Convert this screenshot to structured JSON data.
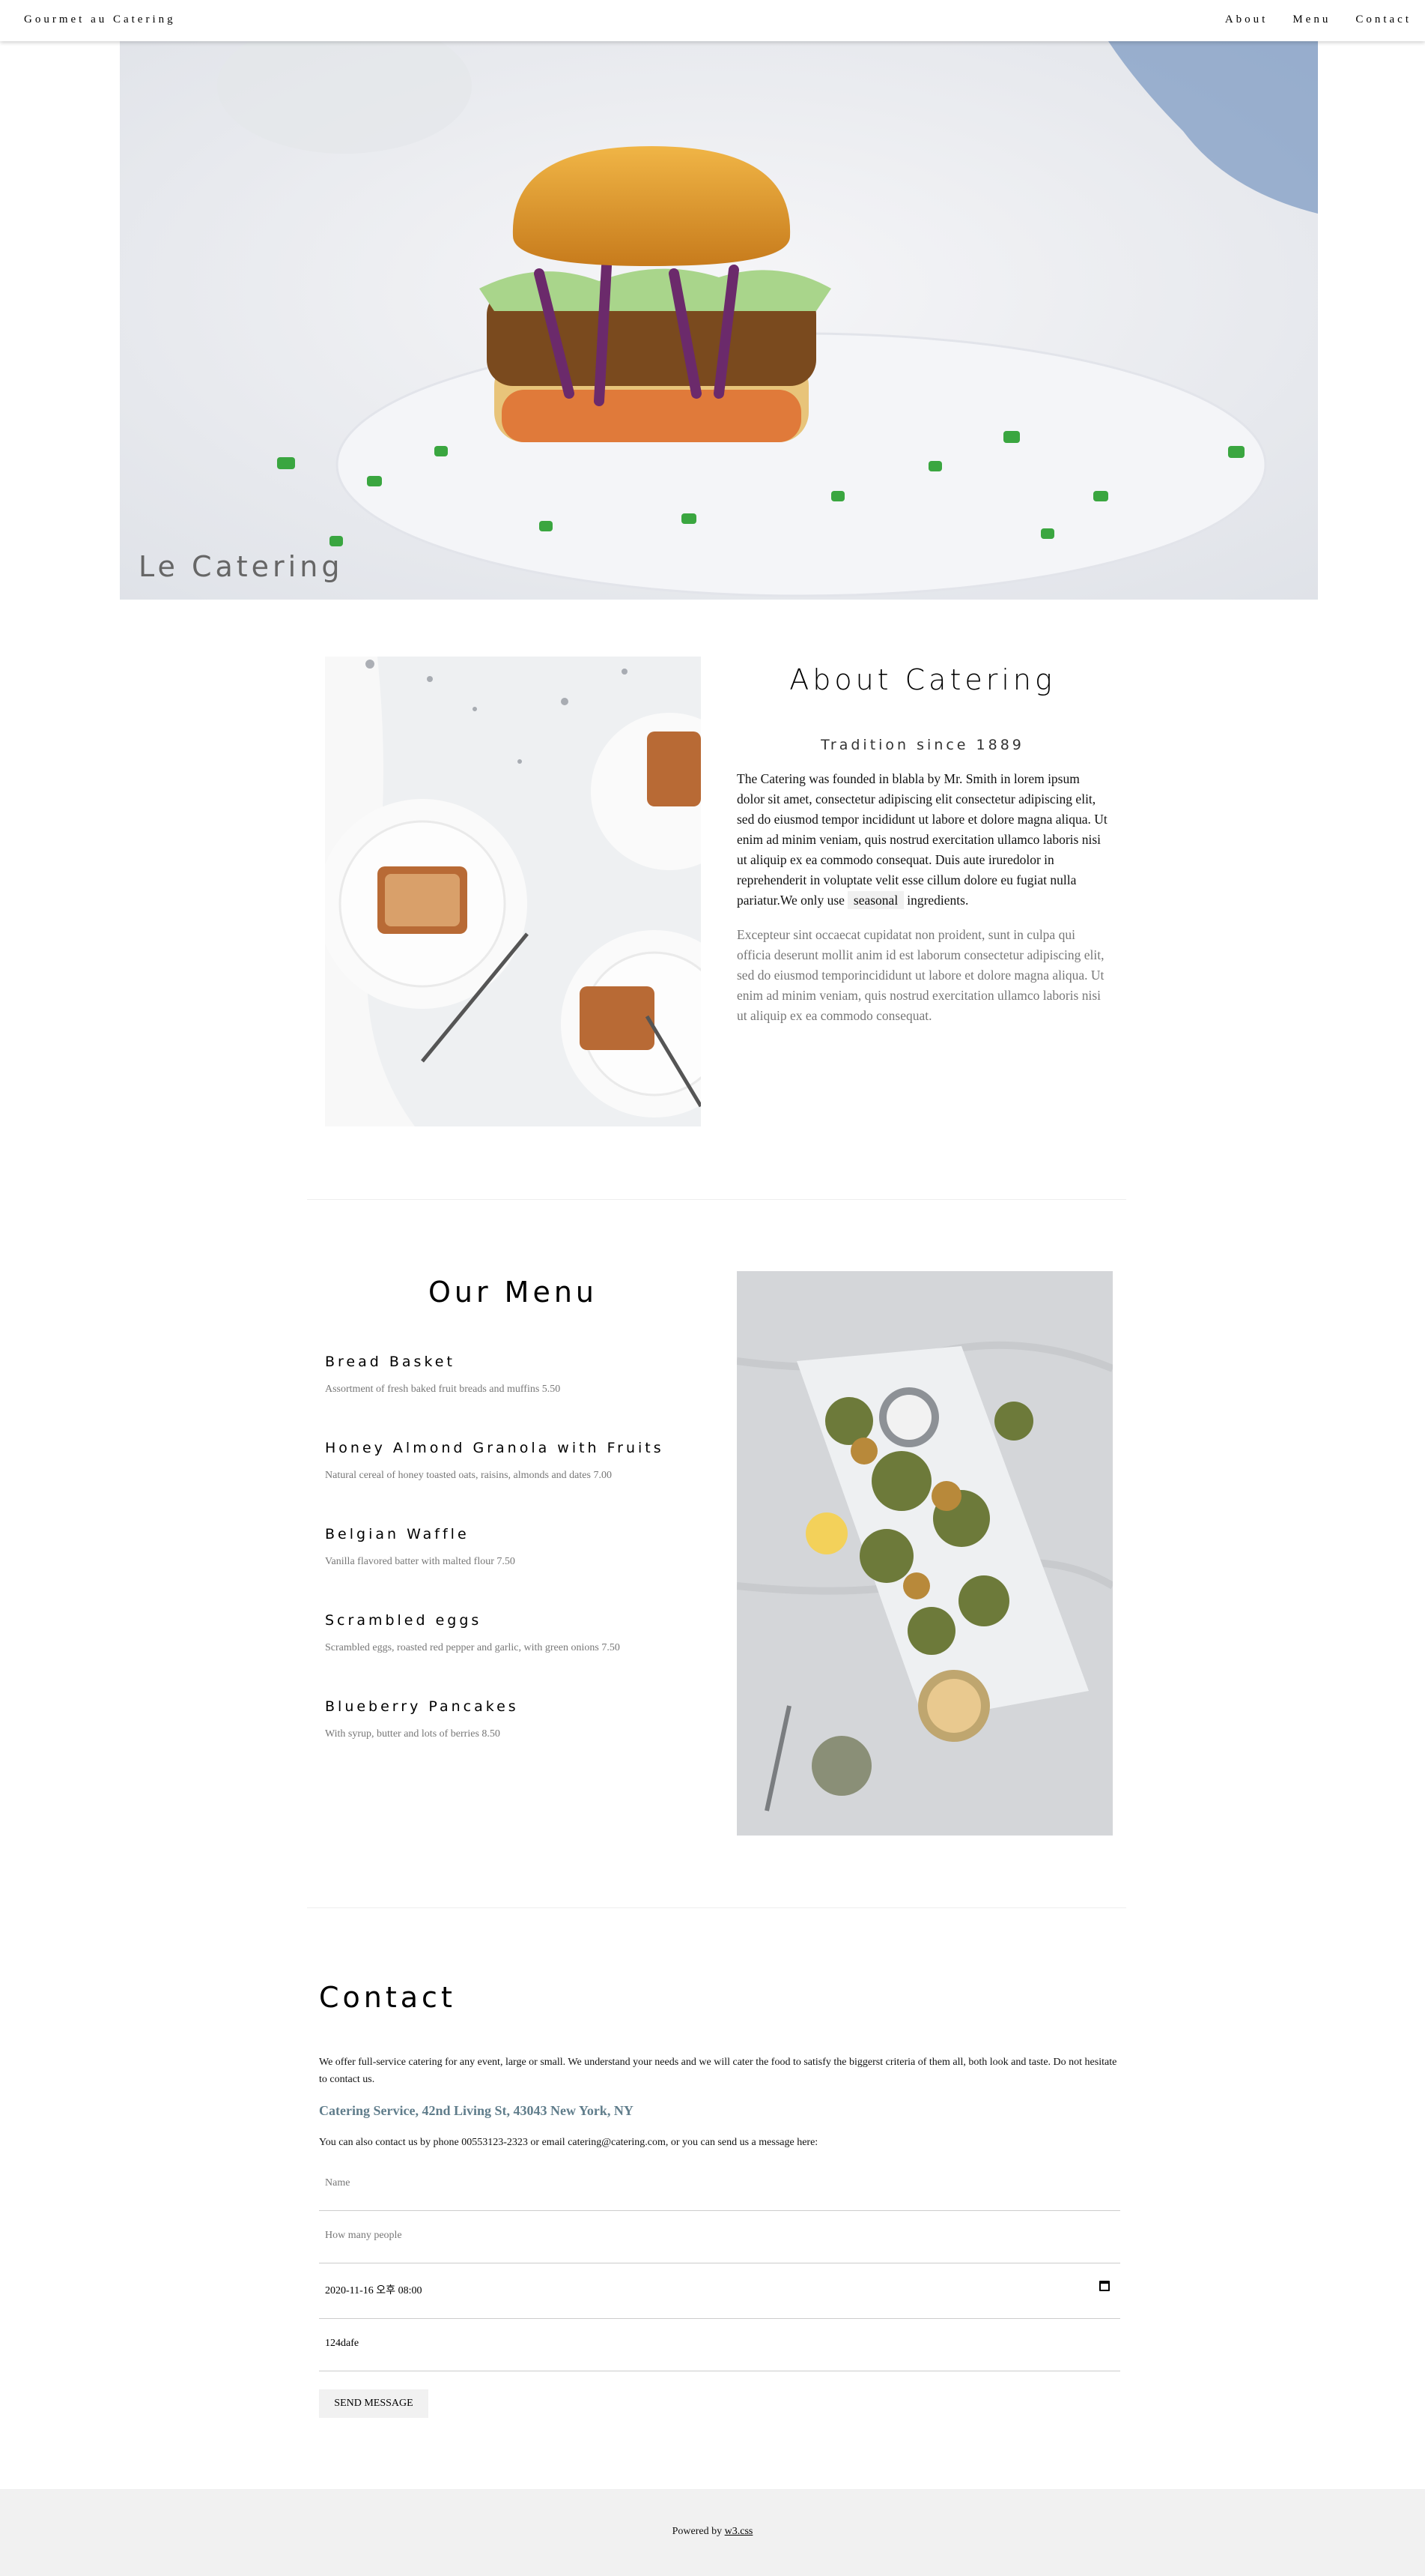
{
  "topbar": {
    "brand": "Gourmet au Catering",
    "nav": [
      "About",
      "Menu",
      "Contact"
    ]
  },
  "hero": {
    "caption": "Le Catering"
  },
  "about": {
    "title": "About Catering",
    "subtitle": "Tradition since 1889",
    "p1_before": "The Catering was founded in blabla by Mr. Smith in lorem ipsum dolor sit amet, consectetur adipiscing elit consectetur adipiscing elit, sed do eiusmod tempor incididunt ut labore et dolore magna aliqua. Ut enim ad minim veniam, quis nostrud exercitation ullamco laboris nisi ut aliquip ex ea commodo consequat. Duis aute iruredolor in reprehenderit in voluptate velit esse cillum dolore eu fugiat nulla pariatur.We only use",
    "p1_tag": "seasonal",
    "p1_after": "ingredients.",
    "p2": "Excepteur sint occaecat cupidatat non proident, sunt in culpa qui officia deserunt mollit anim id est laborum consectetur adipiscing elit, sed do eiusmod temporincididunt ut labore et dolore magna aliqua. Ut enim ad minim veniam, quis nostrud exercitation ullamco laboris nisi ut aliquip ex ea commodo consequat."
  },
  "menu": {
    "title": "Our Menu",
    "items": [
      {
        "name": "Bread Basket",
        "desc": "Assortment of fresh baked fruit breads and muffins 5.50"
      },
      {
        "name": "Honey Almond Granola with Fruits",
        "desc": "Natural cereal of honey toasted oats, raisins, almonds and dates 7.00"
      },
      {
        "name": "Belgian Waffle",
        "desc": "Vanilla flavored batter with malted flour 7.50"
      },
      {
        "name": "Scrambled eggs",
        "desc": "Scrambled eggs, roasted red pepper and garlic, with green onions 7.50"
      },
      {
        "name": "Blueberry Pancakes",
        "desc": "With syrup, butter and lots of berries 8.50"
      }
    ]
  },
  "contact": {
    "title": "Contact",
    "intro": "We offer full-service catering for any event, large or small. We understand your needs and we will cater the food to satisfy the biggerst criteria of them all, both look and taste. Do not hesitate to contact us.",
    "address": "Catering Service, 42nd Living St, 43043 New York, NY",
    "phone_line": "You can also contact us by phone 00553123-2323 or email catering@catering.com, or you can send us a message here:",
    "name_placeholder": "Name",
    "people_placeholder": "How many people",
    "datetime_value": "2020-11-16 오후 08:00",
    "message_value": "124dafe",
    "send_label": "SEND MESSAGE"
  },
  "footer": {
    "powered_by": "Powered by",
    "link": "w3.css"
  }
}
